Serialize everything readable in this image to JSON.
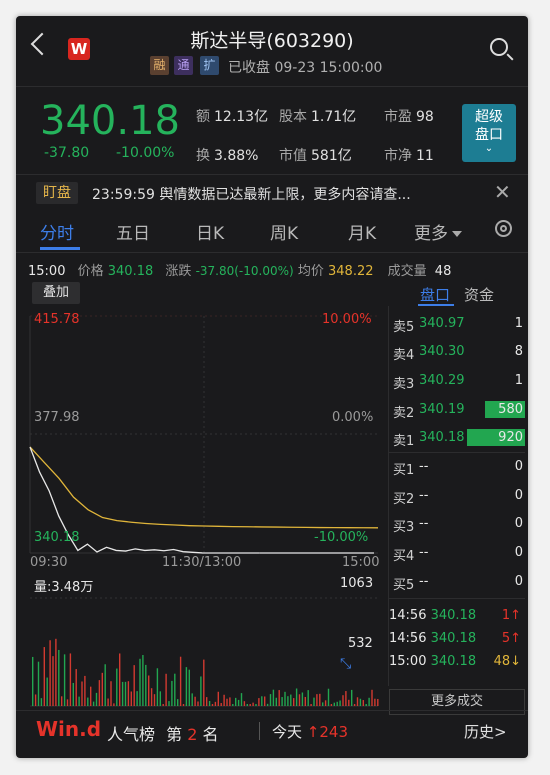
{
  "header": {
    "title": "斯达半导(603290)",
    "tags": [
      "融",
      "通",
      "扩"
    ],
    "status": "已收盘 09-23 15:00:00"
  },
  "quote": {
    "price": "340.18",
    "change": "-37.80",
    "change_pct": "-10.00%",
    "amount_label": "额",
    "amount": "12.13亿",
    "share_cap_label": "股本",
    "share_cap": "1.71亿",
    "pe_label": "市盈",
    "pe": "98",
    "turnover_label": "换",
    "turnover": "3.88%",
    "mkt_cap_label": "市值",
    "mkt_cap": "581亿",
    "pb_label": "市净",
    "pb": "11",
    "super_btn_line1": "超级",
    "super_btn_line2": "盘口"
  },
  "alert": {
    "badge": "盯盘",
    "text": "23:59:59 舆情数据已达最新上限，更多内容请查..."
  },
  "tabs": [
    "分时",
    "五日",
    "日K",
    "周K",
    "月K",
    "更多"
  ],
  "info": {
    "time": "15:00",
    "price_label": "价格",
    "price": "340.18",
    "chg_label": "涨跌",
    "chg": "-37.80(-10.00%)",
    "avg_label": "均价",
    "avg": "348.22",
    "vol_label": "成交量",
    "vol": "48"
  },
  "chart": {
    "overlay_btn": "叠加",
    "y_top": "415.78",
    "y_mid": "377.98",
    "y_bot": "340.18",
    "pct_top": "10.00%",
    "pct_mid": "0.00%",
    "pct_bot": "-10.00%",
    "x_start": "09:30",
    "x_mid": "11:30/13:00",
    "x_end": "15:00",
    "vol_title": "量:3.48万",
    "vol_max": "1063",
    "vol_mid": "532"
  },
  "chart_data": {
    "type": "line",
    "ylim": [
      340.18,
      415.78
    ],
    "series": [
      {
        "name": "价格",
        "values": [
          374,
          366,
          360,
          352,
          346,
          341,
          343,
          340.5,
          342,
          341,
          340.8,
          341.5,
          341,
          341.2,
          340.9,
          341.3,
          340.6,
          340.4,
          340.2,
          340.18,
          340.18,
          340.18,
          340.18,
          340.18,
          340.18
        ]
      },
      {
        "name": "均价",
        "values": [
          374,
          369,
          364,
          358,
          354,
          351.5,
          350.5,
          350,
          349.6,
          349.3,
          349.1,
          348.9,
          348.8,
          348.7,
          348.6,
          348.55,
          348.5,
          348.45,
          348.4,
          348.35,
          348.3,
          348.28,
          348.25,
          348.23,
          348.22
        ]
      }
    ]
  },
  "order_book": {
    "tab_active": "盘口",
    "tab_other": "资金",
    "asks": [
      {
        "label": "卖5",
        "price": "340.97",
        "vol": "1"
      },
      {
        "label": "卖4",
        "price": "340.30",
        "vol": "8"
      },
      {
        "label": "卖3",
        "price": "340.29",
        "vol": "1"
      },
      {
        "label": "卖2",
        "price": "340.19",
        "vol": "580"
      },
      {
        "label": "卖1",
        "price": "340.18",
        "vol": "920"
      }
    ],
    "bids": [
      {
        "label": "买1",
        "price": "--",
        "vol": "0"
      },
      {
        "label": "买2",
        "price": "--",
        "vol": "0"
      },
      {
        "label": "买3",
        "price": "--",
        "vol": "0"
      },
      {
        "label": "买4",
        "price": "--",
        "vol": "0"
      },
      {
        "label": "买5",
        "price": "--",
        "vol": "0"
      }
    ],
    "trades": [
      {
        "time": "14:56",
        "price": "340.18",
        "vol": "1↑"
      },
      {
        "time": "14:56",
        "price": "340.18",
        "vol": "5↑"
      },
      {
        "time": "15:00",
        "price": "340.18",
        "vol": "48↓"
      }
    ],
    "more_trades": "更多成交"
  },
  "bottom": {
    "logo": "Win.d",
    "rank_label": "人气榜",
    "rank_prefix": "第",
    "rank_num": "2",
    "rank_suffix": "名",
    "today_label": "今天",
    "today_value": "↑243",
    "history": "历史>"
  }
}
